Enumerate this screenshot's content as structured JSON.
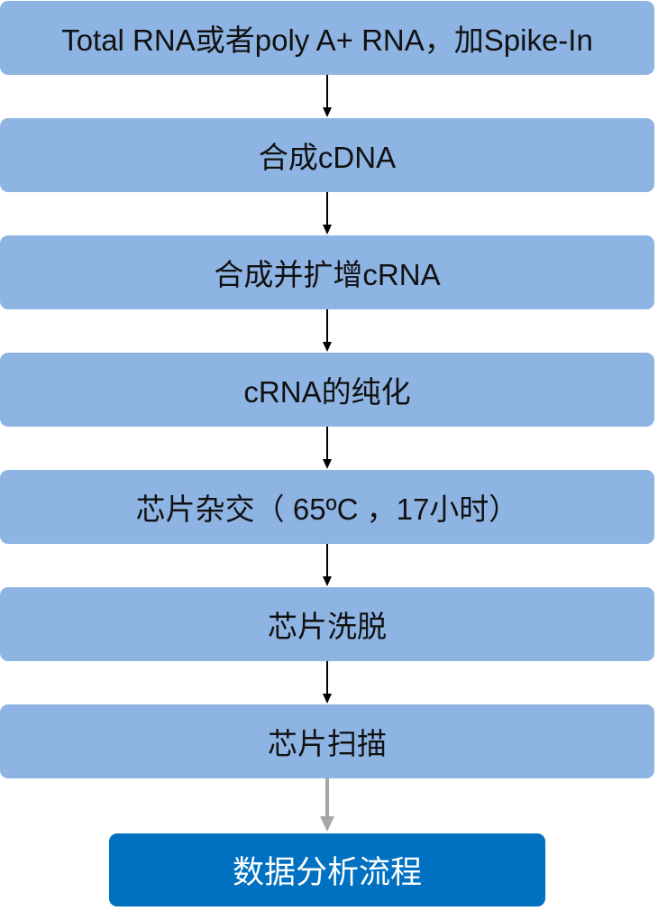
{
  "steps": [
    {
      "label": "Total RNA或者poly A+ RNA，加Spike-In"
    },
    {
      "label": "合成cDNA"
    },
    {
      "label": "合成并扩增cRNA"
    },
    {
      "label": "cRNA的纯化"
    },
    {
      "label": "芯片杂交（ 65ºC ，17小时）"
    },
    {
      "label": "芯片洗脱"
    },
    {
      "label": "芯片扫描"
    }
  ],
  "final_step": {
    "label": "数据分析流程"
  },
  "colors": {
    "step_fill": "#8eb4e3",
    "final_fill": "#0070c0",
    "arrow_dark": "#000000",
    "arrow_gray": "#a6a6a6"
  }
}
